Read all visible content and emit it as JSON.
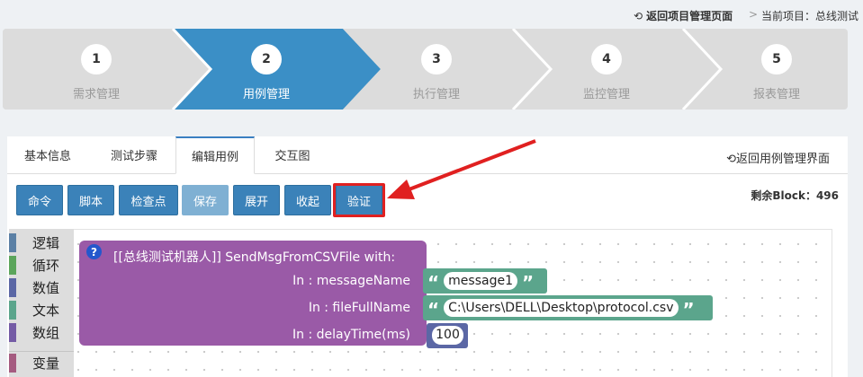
{
  "topbar": {
    "back_project": "返回项目管理页面",
    "separator": ">",
    "current_project": "当前项目：总线测试"
  },
  "wizard": {
    "steps": [
      {
        "num": "1",
        "label": "需求管理",
        "active": false
      },
      {
        "num": "2",
        "label": "用例管理",
        "active": true
      },
      {
        "num": "3",
        "label": "执行管理",
        "active": false
      },
      {
        "num": "4",
        "label": "监控管理",
        "active": false
      },
      {
        "num": "5",
        "label": "报表管理",
        "active": false
      }
    ],
    "active_color": "#3b8fc6",
    "inactive_color": "#dcdcdc"
  },
  "tabs": [
    {
      "label": "基本信息"
    },
    {
      "label": "测试步骤"
    },
    {
      "label": "编辑用例",
      "active": true
    },
    {
      "label": "交互图"
    }
  ],
  "back_case": "返回用例管理界面",
  "toolbar": {
    "buttons": [
      "命令",
      "脚本",
      "检查点",
      "保存",
      "展开",
      "收起",
      "验证"
    ],
    "disabled": "保存",
    "highlighted": "验证"
  },
  "remaining_blocks": "剩余Block：496",
  "categories": [
    {
      "label": "逻辑",
      "color": "#5b80a5"
    },
    {
      "label": "循环",
      "color": "#5ba55b"
    },
    {
      "label": "数值",
      "color": "#5b67a5"
    },
    {
      "label": "文本",
      "color": "#5ba58c"
    },
    {
      "label": "数组",
      "color": "#745ba5"
    },
    {
      "label": "变量",
      "color": "#a55b80"
    }
  ],
  "block": {
    "help": "?",
    "title": "[[总线测试机器人]]  SendMsgFromCSVFile  with:",
    "params": [
      {
        "label": "In : messageName",
        "value": "message1"
      },
      {
        "label": "In : fileFullName",
        "value": "C:\\Users\\DELL\\Desktop\\protocol.csv"
      },
      {
        "label": "In : delayTime(ms)",
        "value": "100"
      }
    ],
    "color": "#9a5aa7"
  },
  "annotation_color": "#e02020"
}
